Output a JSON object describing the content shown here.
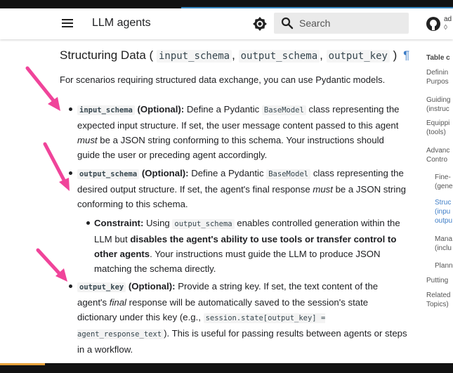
{
  "header": {
    "title": "LLM agents",
    "search_placeholder": "Search",
    "repo_text": "ad",
    "repo_sub": "◊"
  },
  "article": {
    "heading_prefix": "Structuring Data (",
    "heading_code1": "input_schema",
    "heading_comma1": ",",
    "heading_code2": "output_schema",
    "heading_comma2": ",",
    "heading_code3": "output_key",
    "heading_suffix": ")",
    "pilcrow": "¶",
    "intro": "For scenarios requiring structured data exchange, you can use Pydantic models.",
    "b1_code": "input_schema",
    "b1_label": "(Optional):",
    "b1_t1": "Define a Pydantic",
    "b1_code2": "BaseModel",
    "b1_t2": "class representing the expected input structure. If set, the user message content passed to this agent",
    "b1_em": "must",
    "b1_t3": "be a JSON string conforming to this schema. Your instructions should guide the user or preceding agent accordingly.",
    "b2_code": "output_schema",
    "b2_label": "(Optional):",
    "b2_t1": "Define a Pydantic",
    "b2_code2": "BaseModel",
    "b2_t2": "class representing the desired output structure. If set, the agent's final response",
    "b2_em": "must",
    "b2_t3": "be a JSON string conforming to this schema.",
    "c_label": "Constraint:",
    "c_t1": "Using",
    "c_code": "output_schema",
    "c_t2": "enables controlled generation within the LLM but",
    "c_bold": "disables the agent's ability to use tools or transfer control to other agents",
    "c_t3": ". Your instructions must guide the LLM to produce JSON matching the schema directly.",
    "b3_code": "output_key",
    "b3_label": "(Optional):",
    "b3_t1": "Provide a string key. If set, the text content of the agent's",
    "b3_em": "final",
    "b3_t2": "response will be automatically saved to the session's state dictionary under this key (e.g.,",
    "b3_code2": "session.state[output_key] = agent_response_text",
    "b3_t3": "). This is useful for passing results between agents or steps in a workflow."
  },
  "toc": {
    "title": "Table c",
    "items": [
      "Definin\nPurpos",
      "Guiding\n(instruc",
      "Equippi\n(tools)",
      "Advanc\nContro",
      "Fine-\n(gene",
      "Struc\n(inpu\noutpu",
      "Mana\n(inclu",
      "Plann",
      "Putting",
      "Related\nTopics)"
    ]
  },
  "colors": {
    "annotation_arrow": "#f0449a",
    "link": "#3f7ec7",
    "progress": "#e8a33c"
  }
}
